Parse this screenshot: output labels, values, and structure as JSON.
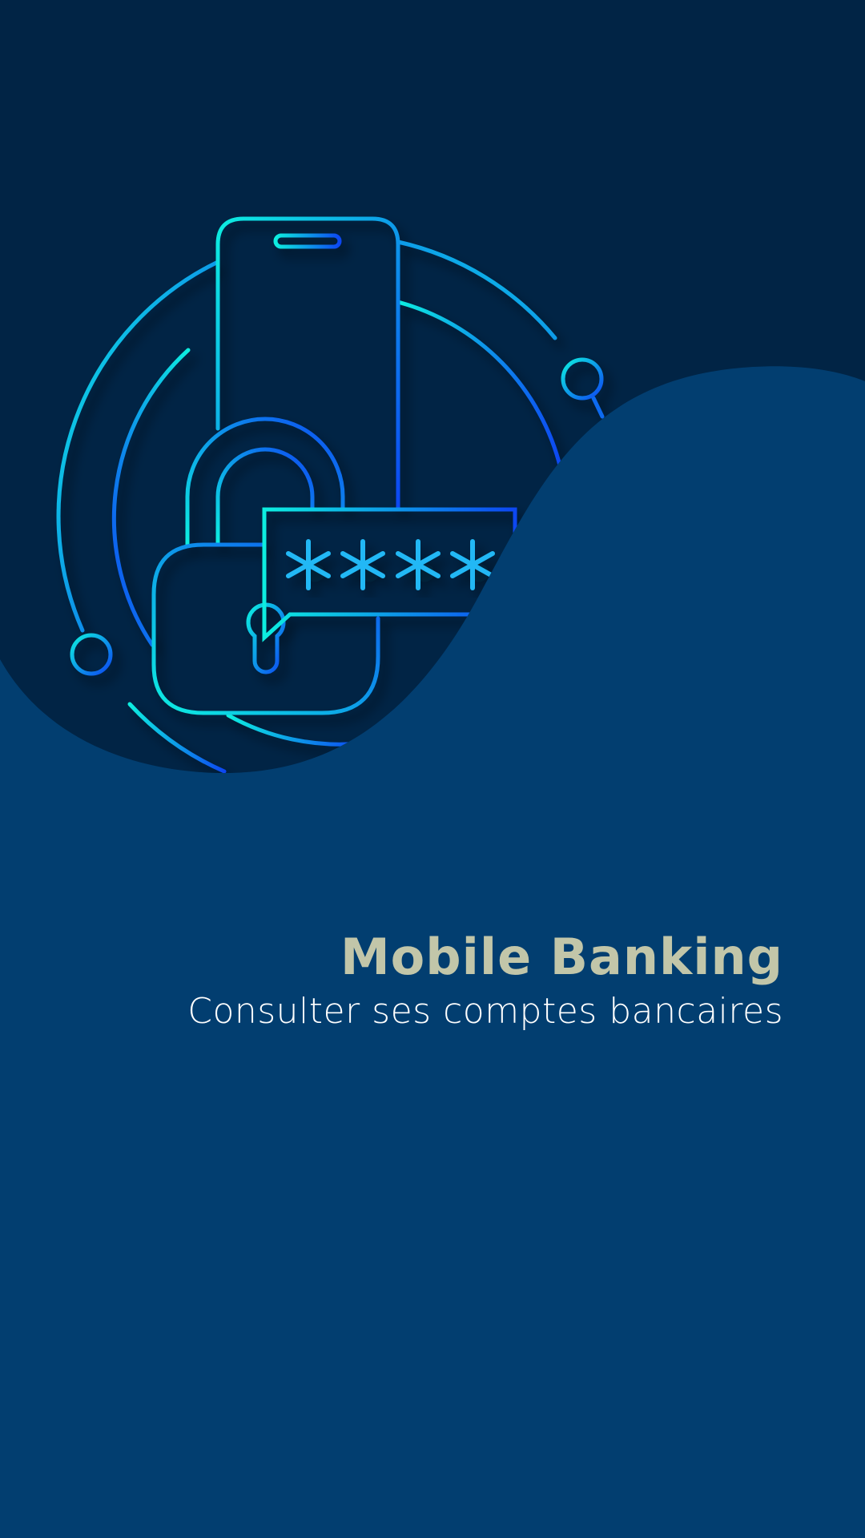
{
  "onboarding": {
    "title": "Mobile Banking",
    "subtitle": "Consulter ses comptes bancaires"
  },
  "illustration": {
    "icon": "phone-padlock-password-icon",
    "password_mask": "****"
  },
  "colors": {
    "background_top": "#012445",
    "background_bottom": "#023e70",
    "title": "#c2c6a9",
    "subtitle": "#ffffff",
    "line_cyan": "#12e6e0",
    "line_blue": "#0a4ff0"
  }
}
